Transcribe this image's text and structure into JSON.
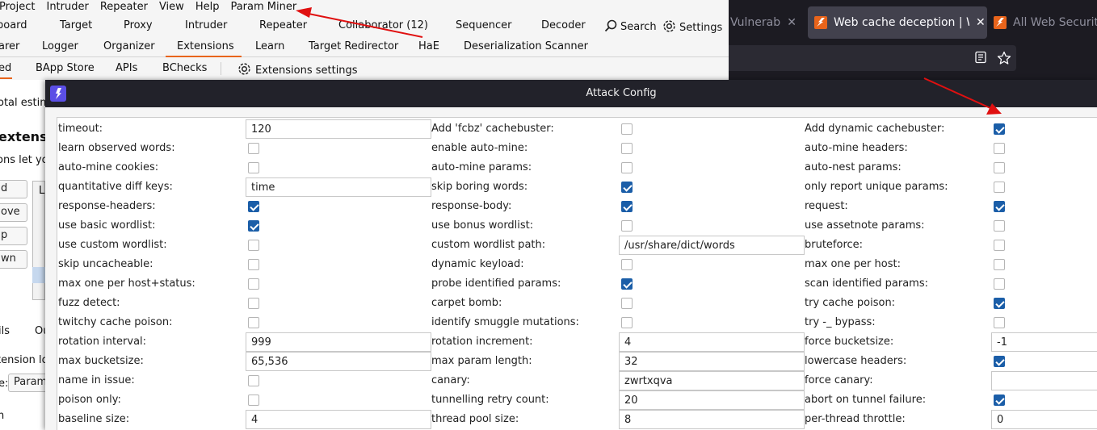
{
  "burp": {
    "menu": [
      "Project",
      "Intruder",
      "Repeater",
      "View",
      "Help",
      "Param Miner"
    ],
    "tabs_row1": [
      "board",
      "Target",
      "Proxy",
      "Intruder",
      "Repeater",
      "Collaborator (12)",
      "Sequencer",
      "Decoder"
    ],
    "search_label": "Search",
    "settings_label": "Settings",
    "tabs_row2": [
      "arer",
      "Logger",
      "Organizer",
      "Extensions",
      "Learn",
      "Target Redirector",
      "HaE",
      "Deserialization Scanner"
    ],
    "subtabs": [
      "ed",
      "BApp Store",
      "APIs",
      "BChecks",
      "Extensions settings"
    ],
    "left_panel": {
      "total": "otal estim",
      "heading": "extensio",
      "desc": "ons let yo",
      "buttons": [
        "d",
        "ove",
        "p",
        "wn"
      ],
      "list_header": "L",
      "tabs": [
        "ils",
        "Ou"
      ],
      "ext_label": "tension lo",
      "select_label": "e:",
      "select_value": "Param",
      "bottom": "n"
    }
  },
  "browser": {
    "tabs": [
      {
        "title": "Vulnerabili",
        "active": false
      },
      {
        "title": "Web cache deception | We",
        "active": true
      },
      {
        "title": "All Web Security",
        "active": false
      }
    ]
  },
  "dialog": {
    "title": "Attack Config",
    "rows": [
      [
        {
          "label": "timeout:",
          "type": "text",
          "value": "120"
        },
        {
          "label": "Add 'fcbz' cachebuster:",
          "type": "check",
          "checked": false
        },
        {
          "label": "Add dynamic cachebuster:",
          "type": "check",
          "checked": true
        }
      ],
      [
        {
          "label": "learn observed words:",
          "type": "check",
          "checked": false
        },
        {
          "label": "enable auto-mine:",
          "type": "check",
          "checked": false
        },
        {
          "label": "auto-mine headers:",
          "type": "check",
          "checked": false
        }
      ],
      [
        {
          "label": "auto-mine cookies:",
          "type": "check",
          "checked": false
        },
        {
          "label": "auto-mine params:",
          "type": "check",
          "checked": false
        },
        {
          "label": "auto-nest params:",
          "type": "check",
          "checked": false
        }
      ],
      [
        {
          "label": "quantitative diff keys:",
          "type": "text",
          "value": "time"
        },
        {
          "label": "skip boring words:",
          "type": "check",
          "checked": true
        },
        {
          "label": "only report unique params:",
          "type": "check",
          "checked": false
        }
      ],
      [
        {
          "label": "response-headers:",
          "type": "check",
          "checked": true
        },
        {
          "label": "response-body:",
          "type": "check",
          "checked": true
        },
        {
          "label": "request:",
          "type": "check",
          "checked": true
        }
      ],
      [
        {
          "label": "use basic wordlist:",
          "type": "check",
          "checked": true
        },
        {
          "label": "use bonus wordlist:",
          "type": "check",
          "checked": false
        },
        {
          "label": "use assetnote params:",
          "type": "check",
          "checked": false
        }
      ],
      [
        {
          "label": "use custom wordlist:",
          "type": "check",
          "checked": false
        },
        {
          "label": "custom wordlist path:",
          "type": "text",
          "value": "/usr/share/dict/words"
        },
        {
          "label": "bruteforce:",
          "type": "check",
          "checked": false
        }
      ],
      [
        {
          "label": "skip uncacheable:",
          "type": "check",
          "checked": false
        },
        {
          "label": "dynamic keyload:",
          "type": "check",
          "checked": false
        },
        {
          "label": "max one per host:",
          "type": "check",
          "checked": false
        }
      ],
      [
        {
          "label": "max one per host+status:",
          "type": "check",
          "checked": false
        },
        {
          "label": "probe identified params:",
          "type": "check",
          "checked": true
        },
        {
          "label": "scan identified params:",
          "type": "check",
          "checked": false
        }
      ],
      [
        {
          "label": "fuzz detect:",
          "type": "check",
          "checked": false
        },
        {
          "label": "carpet bomb:",
          "type": "check",
          "checked": false
        },
        {
          "label": "try cache poison:",
          "type": "check",
          "checked": true
        }
      ],
      [
        {
          "label": "twitchy cache poison:",
          "type": "check",
          "checked": false
        },
        {
          "label": "identify smuggle mutations:",
          "type": "check",
          "checked": false
        },
        {
          "label": "try -_ bypass:",
          "type": "check",
          "checked": false
        }
      ],
      [
        {
          "label": "rotation interval:",
          "type": "text",
          "value": "999"
        },
        {
          "label": "rotation increment:",
          "type": "text",
          "value": "4"
        },
        {
          "label": "force bucketsize:",
          "type": "text",
          "value": "-1"
        }
      ],
      [
        {
          "label": "max bucketsize:",
          "type": "text",
          "value": "65,536"
        },
        {
          "label": "max param length:",
          "type": "text",
          "value": "32"
        },
        {
          "label": "lowercase headers:",
          "type": "check",
          "checked": true
        }
      ],
      [
        {
          "label": "name in issue:",
          "type": "check",
          "checked": false
        },
        {
          "label": "canary:",
          "type": "text",
          "value": "zwrtxqva"
        },
        {
          "label": "force canary:",
          "type": "text",
          "value": ""
        }
      ],
      [
        {
          "label": "poison only:",
          "type": "check",
          "checked": false
        },
        {
          "label": "tunnelling retry count:",
          "type": "text",
          "value": "20"
        },
        {
          "label": "abort on tunnel failure:",
          "type": "check",
          "checked": true
        }
      ],
      [
        {
          "label": "baseline size:",
          "type": "text",
          "value": "4"
        },
        {
          "label": "thread pool size:",
          "type": "text",
          "value": "8"
        },
        {
          "label": "per-thread throttle:",
          "type": "text",
          "value": "0"
        }
      ]
    ]
  },
  "colors": {
    "accent": "#e8641b",
    "checkbox_on": "#1b5ea8",
    "arrow": "#e01010",
    "dialog_title_bg": "#22222a"
  }
}
